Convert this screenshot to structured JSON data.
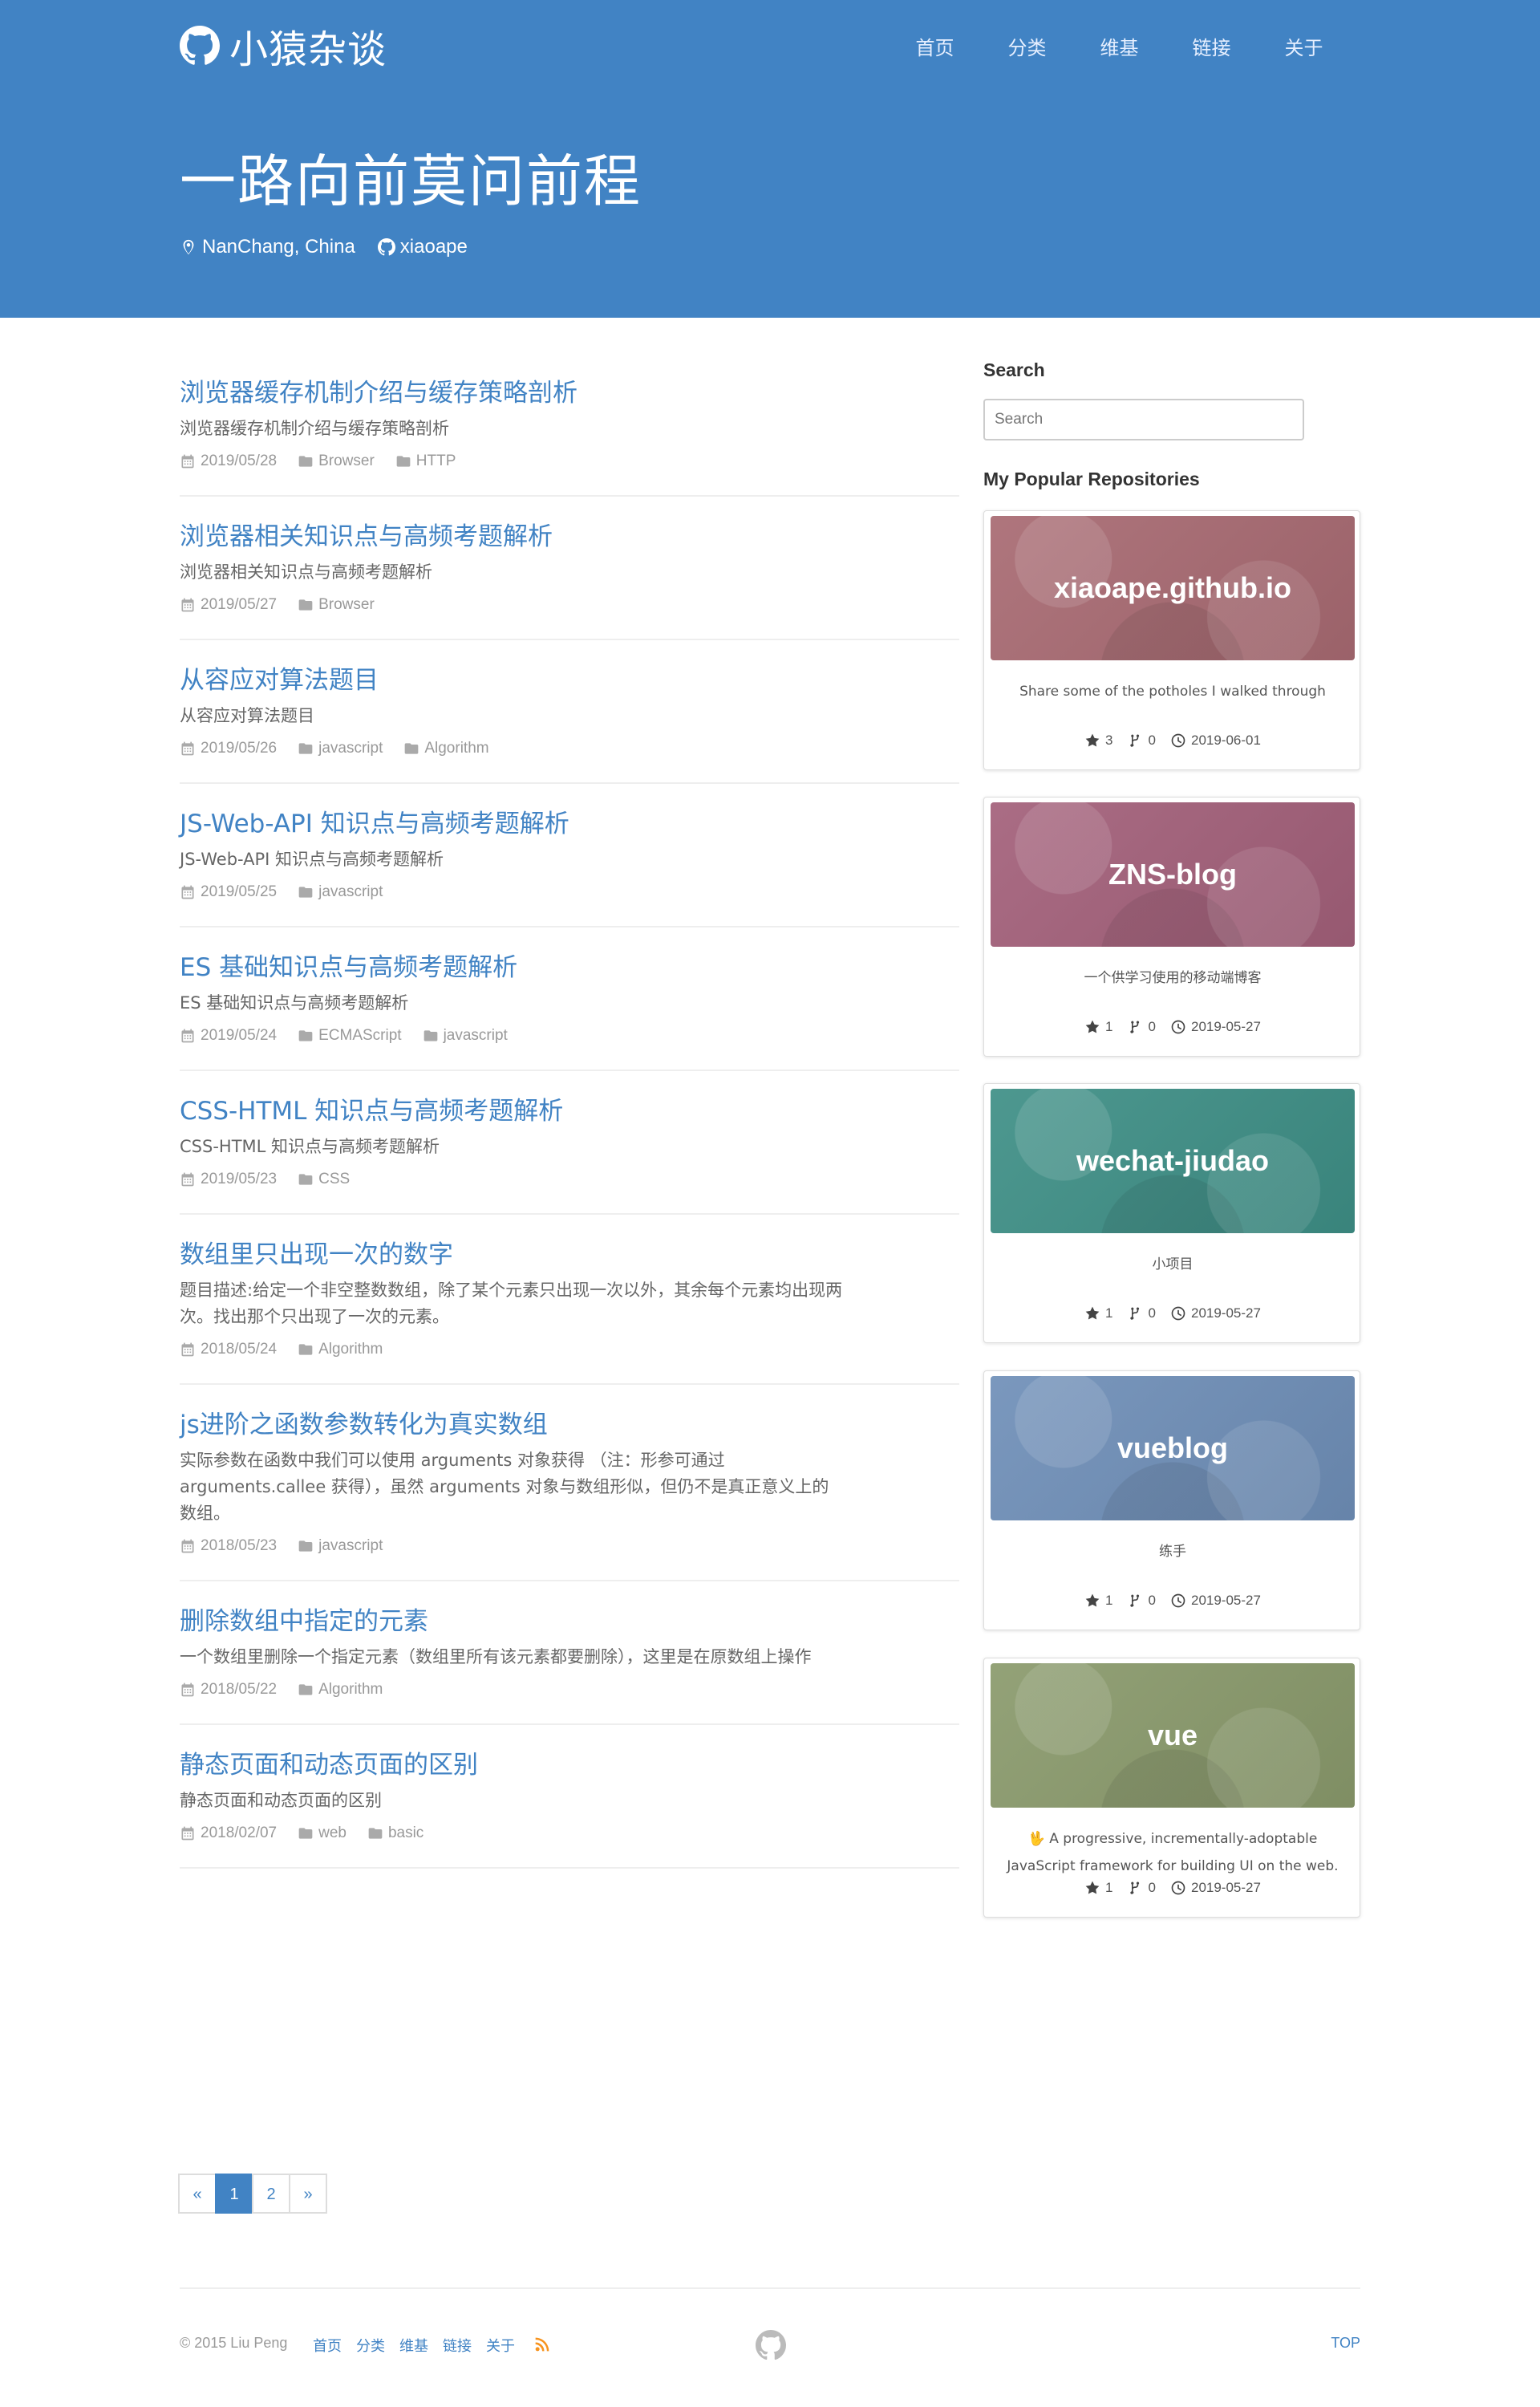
{
  "brand": {
    "name": "小猿杂谈"
  },
  "nav": [
    "首页",
    "分类",
    "维基",
    "链接",
    "关于"
  ],
  "hero": {
    "title": "一路向前莫问前程",
    "location": "NanChang, China",
    "github": "xiaoape"
  },
  "posts": [
    {
      "title": "浏览器缓存机制介绍与缓存策略剖析",
      "excerpt": "浏览器缓存机制介绍与缓存策略剖析",
      "date": "2019/05/28",
      "categories": [
        "Browser",
        "HTTP"
      ]
    },
    {
      "title": "浏览器相关知识点与高频考题解析",
      "excerpt": "浏览器相关知识点与高频考题解析",
      "date": "2019/05/27",
      "categories": [
        "Browser"
      ]
    },
    {
      "title": "从容应对算法题目",
      "excerpt": "从容应对算法题目",
      "date": "2019/05/26",
      "categories": [
        "javascript",
        "Algorithm"
      ]
    },
    {
      "title": "JS-Web-API 知识点与高频考题解析",
      "excerpt": "JS-Web-API 知识点与高频考题解析",
      "date": "2019/05/25",
      "categories": [
        "javascript"
      ]
    },
    {
      "title": "ES 基础知识点与高频考题解析",
      "excerpt": "ES 基础知识点与高频考题解析",
      "date": "2019/05/24",
      "categories": [
        "ECMAScript",
        "javascript"
      ]
    },
    {
      "title": "CSS-HTML 知识点与高频考题解析",
      "excerpt": "CSS-HTML 知识点与高频考题解析",
      "date": "2019/05/23",
      "categories": [
        "CSS"
      ]
    },
    {
      "title": "数组里只出现一次的数字",
      "excerpt": "题目描述:给定一个非空整数数组，除了某个元素只出现一次以外，其余每个元素均出现两次。找出那个只出现了一次的元素。",
      "date": "2018/05/24",
      "categories": [
        "Algorithm"
      ]
    },
    {
      "title": "js进阶之函数参数转化为真实数组",
      "excerpt": "实际参数在函数中我们可以使用 arguments 对象获得 （注：形参可通过 arguments.callee 获得），虽然 arguments 对象与数组形似，但仍不是真正意义上的数组。",
      "date": "2018/05/23",
      "categories": [
        "javascript"
      ]
    },
    {
      "title": "删除数组中指定的元素",
      "excerpt": "一个数组里删除一个指定元素（数组里所有该元素都要删除），这里是在原数组上操作",
      "date": "2018/05/22",
      "categories": [
        "Algorithm"
      ]
    },
    {
      "title": "静态页面和动态页面的区别",
      "excerpt": "静态页面和动态页面的区别",
      "date": "2018/02/07",
      "categories": [
        "web",
        "basic"
      ]
    }
  ],
  "pagination": {
    "prev": "«",
    "pages": [
      "1",
      "2"
    ],
    "next": "»",
    "current": "1"
  },
  "sidebar": {
    "search_heading": "Search",
    "search_placeholder": "Search",
    "repos_heading": "My Popular Repositories",
    "repos": [
      {
        "name": "xiaoape.github.io",
        "desc": "Share some of the potholes I walked through",
        "stars": "3",
        "forks": "0",
        "date": "2019-06-01",
        "color": "#a86a72"
      },
      {
        "name": "ZNS-blog",
        "desc": "一个供学习使用的移动端博客",
        "stars": "1",
        "forks": "0",
        "date": "2019-05-27",
        "color": "#a3607a"
      },
      {
        "name": "wechat-jiudao",
        "desc": "小项目",
        "stars": "1",
        "forks": "0",
        "date": "2019-05-27",
        "color": "#3e8f86"
      },
      {
        "name": "vueblog",
        "desc": "练手",
        "stars": "1",
        "forks": "0",
        "date": "2019-05-27",
        "color": "#6f8fb8"
      },
      {
        "name": "vue",
        "desc": "🖖 A progressive, incrementally-adoptable JavaScript framework for building UI on the web.",
        "stars": "1",
        "forks": "0",
        "date": "2019-05-27",
        "color": "#8a9a6c"
      }
    ]
  },
  "footer": {
    "copyright": "© 2015 Liu Peng",
    "links": [
      "首页",
      "分类",
      "维基",
      "链接",
      "关于"
    ],
    "top": "TOP"
  },
  "colors": {
    "primary": "#4183c4"
  }
}
